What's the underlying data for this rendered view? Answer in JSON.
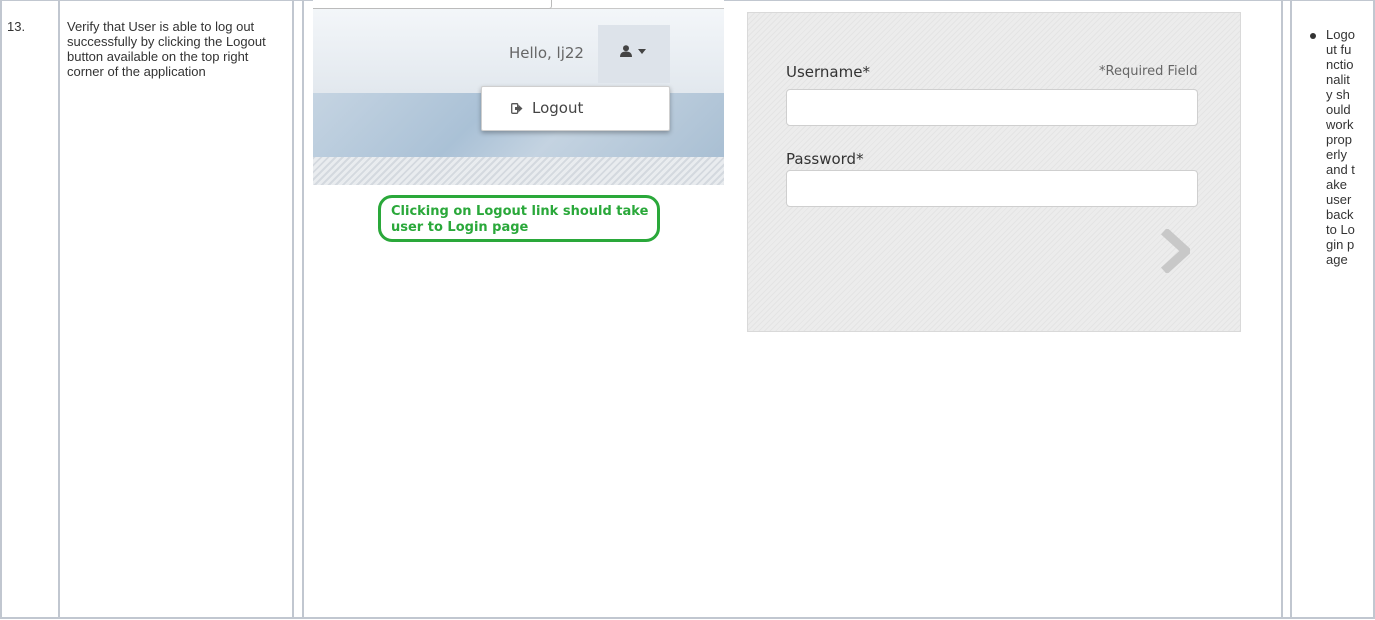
{
  "row": {
    "number": "13.",
    "description": "Verify that User is able to log out successfully by clicking the Logout button available on the top right corner of the application",
    "expected_result": "Logout functionality should work properly and take user back to Login page"
  },
  "screenshot_left": {
    "greeting": "Hello, lj22",
    "menu": {
      "logout_label": "Logout"
    },
    "annotation": "Clicking on Logout link should take user to Login page"
  },
  "login_form": {
    "username_label": "Username*",
    "required_note": "*Required Field",
    "password_label": "Password*",
    "submit_icon": "chevron-right-icon"
  },
  "colors": {
    "annotation": "#2aa83a",
    "grid": "#c1c7d0"
  },
  "icons": [
    "user-icon",
    "caret-down-icon",
    "logout-icon",
    "chevron-right-icon",
    "bullet-icon"
  ]
}
